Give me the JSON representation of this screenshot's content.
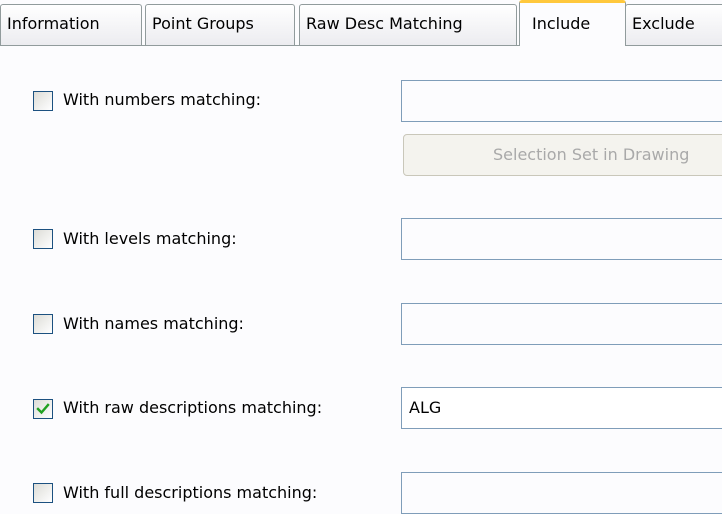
{
  "tabs": [
    {
      "label": "Information"
    },
    {
      "label": "Point Groups"
    },
    {
      "label": "Raw Desc Matching"
    },
    {
      "label": "Include"
    },
    {
      "label": "Exclude"
    }
  ],
  "rows": [
    {
      "label": "With numbers matching:",
      "checked": false,
      "value": ""
    },
    {
      "label": "With levels matching:",
      "checked": false,
      "value": ""
    },
    {
      "label": "With names matching:",
      "checked": false,
      "value": ""
    },
    {
      "label": "With raw descriptions matching:",
      "checked": true,
      "value": "ALG"
    },
    {
      "label": "With full descriptions matching:",
      "checked": false,
      "value": ""
    }
  ],
  "selection_button_label": "Selection Set in Drawing",
  "colors": {
    "active_tab_accent": "#ffc83c",
    "checkbox_border": "#1c5180",
    "check_mark": "#21a121",
    "field_border": "#7f9db9"
  }
}
